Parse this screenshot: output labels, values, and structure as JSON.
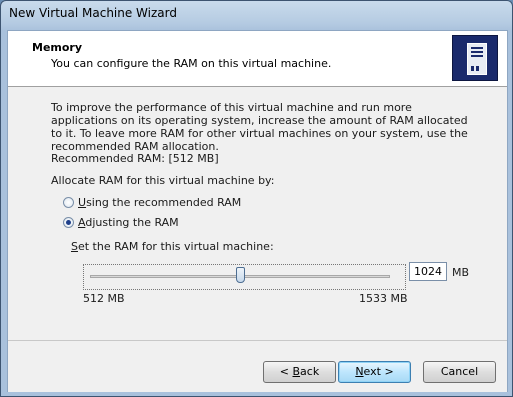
{
  "window": {
    "title": "New Virtual Machine Wizard"
  },
  "header": {
    "title": "Memory",
    "subtitle": "You can configure the RAM on this virtual machine.",
    "icon": "server-tower-icon"
  },
  "content": {
    "intro": "To improve the performance of this virtual machine and run more applications on its operating system, increase the amount of RAM allocated to it. To leave more RAM for other virtual machines on your system, use the recommended RAM allocation.",
    "recommended": "Recommended RAM: [512 MB]",
    "allocate_label": "Allocate RAM for this virtual machine by:",
    "options": [
      {
        "label_pre": "",
        "accel": "U",
        "label_post": "sing the recommended RAM",
        "selected": false
      },
      {
        "label_pre": "",
        "accel": "A",
        "label_post": "djusting the RAM",
        "selected": true
      }
    ],
    "set_label_accel": "S",
    "set_label_rest": "et the RAM for this virtual machine:",
    "slider": {
      "min_label": "512 MB",
      "max_label": "1533 MB",
      "min": 512,
      "max": 1533,
      "value": 1024
    },
    "ram_value": "1024",
    "ram_unit": "MB"
  },
  "buttons": {
    "back_pre": "< ",
    "back_accel": "B",
    "back_post": "ack",
    "next_pre": "",
    "next_accel": "N",
    "next_post": "ext >",
    "cancel": "Cancel"
  }
}
